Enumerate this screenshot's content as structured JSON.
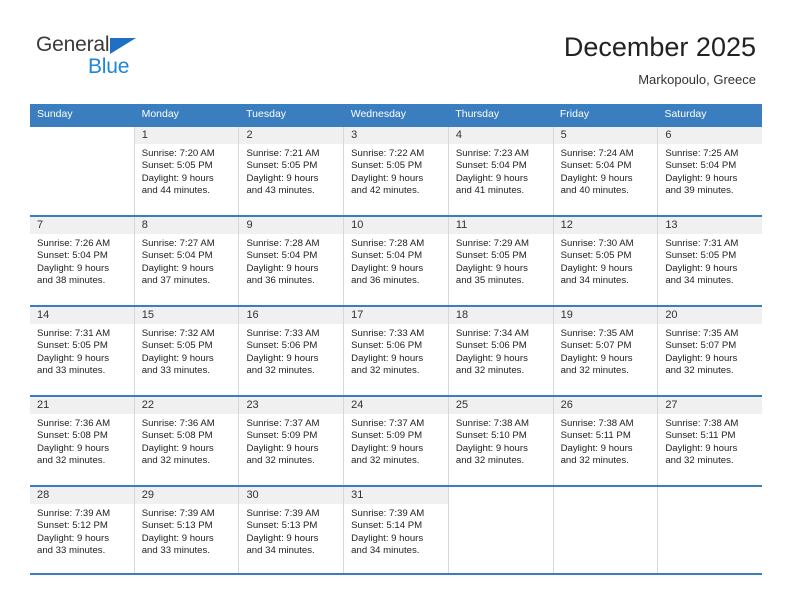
{
  "logo": {
    "word_top": "General",
    "word_bottom": "Blue",
    "triangle_color": "#1f6fc4",
    "blue_color": "#1f86d8"
  },
  "header": {
    "title": "December 2025",
    "subtitle": "Markopoulo, Greece"
  },
  "theme": {
    "header_blue": "#3a7ec0",
    "daynum_band": "#f0f0f0",
    "cell_border": "#d8d8d8"
  },
  "weekdays": [
    "Sunday",
    "Monday",
    "Tuesday",
    "Wednesday",
    "Thursday",
    "Friday",
    "Saturday"
  ],
  "weeks": [
    [
      {
        "day": "",
        "empty": true
      },
      {
        "day": "1",
        "sunrise": "Sunrise: 7:20 AM",
        "sunset": "Sunset: 5:05 PM",
        "daylight1": "Daylight: 9 hours",
        "daylight2": "and 44 minutes."
      },
      {
        "day": "2",
        "sunrise": "Sunrise: 7:21 AM",
        "sunset": "Sunset: 5:05 PM",
        "daylight1": "Daylight: 9 hours",
        "daylight2": "and 43 minutes."
      },
      {
        "day": "3",
        "sunrise": "Sunrise: 7:22 AM",
        "sunset": "Sunset: 5:05 PM",
        "daylight1": "Daylight: 9 hours",
        "daylight2": "and 42 minutes."
      },
      {
        "day": "4",
        "sunrise": "Sunrise: 7:23 AM",
        "sunset": "Sunset: 5:04 PM",
        "daylight1": "Daylight: 9 hours",
        "daylight2": "and 41 minutes."
      },
      {
        "day": "5",
        "sunrise": "Sunrise: 7:24 AM",
        "sunset": "Sunset: 5:04 PM",
        "daylight1": "Daylight: 9 hours",
        "daylight2": "and 40 minutes."
      },
      {
        "day": "6",
        "sunrise": "Sunrise: 7:25 AM",
        "sunset": "Sunset: 5:04 PM",
        "daylight1": "Daylight: 9 hours",
        "daylight2": "and 39 minutes."
      }
    ],
    [
      {
        "day": "7",
        "sunrise": "Sunrise: 7:26 AM",
        "sunset": "Sunset: 5:04 PM",
        "daylight1": "Daylight: 9 hours",
        "daylight2": "and 38 minutes."
      },
      {
        "day": "8",
        "sunrise": "Sunrise: 7:27 AM",
        "sunset": "Sunset: 5:04 PM",
        "daylight1": "Daylight: 9 hours",
        "daylight2": "and 37 minutes."
      },
      {
        "day": "9",
        "sunrise": "Sunrise: 7:28 AM",
        "sunset": "Sunset: 5:04 PM",
        "daylight1": "Daylight: 9 hours",
        "daylight2": "and 36 minutes."
      },
      {
        "day": "10",
        "sunrise": "Sunrise: 7:28 AM",
        "sunset": "Sunset: 5:04 PM",
        "daylight1": "Daylight: 9 hours",
        "daylight2": "and 36 minutes."
      },
      {
        "day": "11",
        "sunrise": "Sunrise: 7:29 AM",
        "sunset": "Sunset: 5:05 PM",
        "daylight1": "Daylight: 9 hours",
        "daylight2": "and 35 minutes."
      },
      {
        "day": "12",
        "sunrise": "Sunrise: 7:30 AM",
        "sunset": "Sunset: 5:05 PM",
        "daylight1": "Daylight: 9 hours",
        "daylight2": "and 34 minutes."
      },
      {
        "day": "13",
        "sunrise": "Sunrise: 7:31 AM",
        "sunset": "Sunset: 5:05 PM",
        "daylight1": "Daylight: 9 hours",
        "daylight2": "and 34 minutes."
      }
    ],
    [
      {
        "day": "14",
        "sunrise": "Sunrise: 7:31 AM",
        "sunset": "Sunset: 5:05 PM",
        "daylight1": "Daylight: 9 hours",
        "daylight2": "and 33 minutes."
      },
      {
        "day": "15",
        "sunrise": "Sunrise: 7:32 AM",
        "sunset": "Sunset: 5:05 PM",
        "daylight1": "Daylight: 9 hours",
        "daylight2": "and 33 minutes."
      },
      {
        "day": "16",
        "sunrise": "Sunrise: 7:33 AM",
        "sunset": "Sunset: 5:06 PM",
        "daylight1": "Daylight: 9 hours",
        "daylight2": "and 32 minutes."
      },
      {
        "day": "17",
        "sunrise": "Sunrise: 7:33 AM",
        "sunset": "Sunset: 5:06 PM",
        "daylight1": "Daylight: 9 hours",
        "daylight2": "and 32 minutes."
      },
      {
        "day": "18",
        "sunrise": "Sunrise: 7:34 AM",
        "sunset": "Sunset: 5:06 PM",
        "daylight1": "Daylight: 9 hours",
        "daylight2": "and 32 minutes."
      },
      {
        "day": "19",
        "sunrise": "Sunrise: 7:35 AM",
        "sunset": "Sunset: 5:07 PM",
        "daylight1": "Daylight: 9 hours",
        "daylight2": "and 32 minutes."
      },
      {
        "day": "20",
        "sunrise": "Sunrise: 7:35 AM",
        "sunset": "Sunset: 5:07 PM",
        "daylight1": "Daylight: 9 hours",
        "daylight2": "and 32 minutes."
      }
    ],
    [
      {
        "day": "21",
        "sunrise": "Sunrise: 7:36 AM",
        "sunset": "Sunset: 5:08 PM",
        "daylight1": "Daylight: 9 hours",
        "daylight2": "and 32 minutes."
      },
      {
        "day": "22",
        "sunrise": "Sunrise: 7:36 AM",
        "sunset": "Sunset: 5:08 PM",
        "daylight1": "Daylight: 9 hours",
        "daylight2": "and 32 minutes."
      },
      {
        "day": "23",
        "sunrise": "Sunrise: 7:37 AM",
        "sunset": "Sunset: 5:09 PM",
        "daylight1": "Daylight: 9 hours",
        "daylight2": "and 32 minutes."
      },
      {
        "day": "24",
        "sunrise": "Sunrise: 7:37 AM",
        "sunset": "Sunset: 5:09 PM",
        "daylight1": "Daylight: 9 hours",
        "daylight2": "and 32 minutes."
      },
      {
        "day": "25",
        "sunrise": "Sunrise: 7:38 AM",
        "sunset": "Sunset: 5:10 PM",
        "daylight1": "Daylight: 9 hours",
        "daylight2": "and 32 minutes."
      },
      {
        "day": "26",
        "sunrise": "Sunrise: 7:38 AM",
        "sunset": "Sunset: 5:11 PM",
        "daylight1": "Daylight: 9 hours",
        "daylight2": "and 32 minutes."
      },
      {
        "day": "27",
        "sunrise": "Sunrise: 7:38 AM",
        "sunset": "Sunset: 5:11 PM",
        "daylight1": "Daylight: 9 hours",
        "daylight2": "and 32 minutes."
      }
    ],
    [
      {
        "day": "28",
        "sunrise": "Sunrise: 7:39 AM",
        "sunset": "Sunset: 5:12 PM",
        "daylight1": "Daylight: 9 hours",
        "daylight2": "and 33 minutes."
      },
      {
        "day": "29",
        "sunrise": "Sunrise: 7:39 AM",
        "sunset": "Sunset: 5:13 PM",
        "daylight1": "Daylight: 9 hours",
        "daylight2": "and 33 minutes."
      },
      {
        "day": "30",
        "sunrise": "Sunrise: 7:39 AM",
        "sunset": "Sunset: 5:13 PM",
        "daylight1": "Daylight: 9 hours",
        "daylight2": "and 34 minutes."
      },
      {
        "day": "31",
        "sunrise": "Sunrise: 7:39 AM",
        "sunset": "Sunset: 5:14 PM",
        "daylight1": "Daylight: 9 hours",
        "daylight2": "and 34 minutes."
      },
      {
        "day": "",
        "empty": true
      },
      {
        "day": "",
        "empty": true
      },
      {
        "day": "",
        "empty": true
      }
    ]
  ]
}
